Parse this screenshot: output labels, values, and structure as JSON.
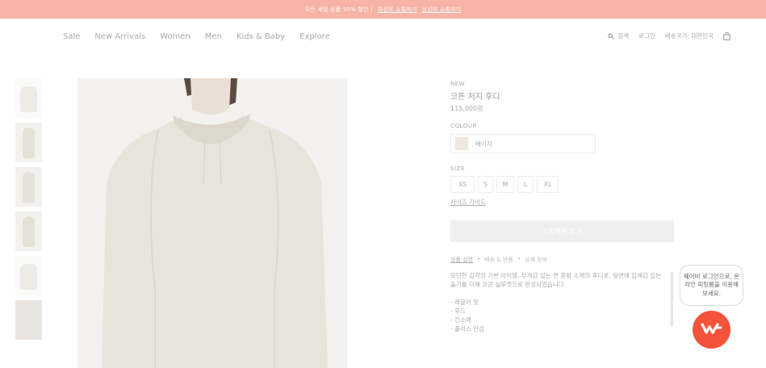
{
  "promo": {
    "text": "모든 세일 상품 50% 할인 |",
    "link_women": "여성의 쇼핑하기",
    "link_men": "남성의 쇼핑하기"
  },
  "nav": {
    "items": [
      "Sale",
      "New Arrivals",
      "Women",
      "Men",
      "Kids & Baby",
      "Explore"
    ]
  },
  "utility": {
    "search": "검색",
    "login": "로그인",
    "shipping": "배송국가: 대한민국",
    "icons": [
      "search-icon",
      "bag-icon"
    ]
  },
  "product": {
    "badge": "NEW",
    "name": "코튼 저지 후디",
    "price": "115,000원",
    "colour_label": "COLOUR",
    "colour_value": "베이지",
    "colour_swatch": "#efe8df",
    "size_label": "SIZE",
    "sizes": [
      "XS",
      "S",
      "M",
      "L",
      "XL"
    ],
    "size_guide": "사이즈 가이드",
    "add_to_cart": "쇼핑백에 담기",
    "tabs": [
      "상품 설명",
      "배송 & 반품",
      "상세 정보"
    ],
    "tab_separator": "•",
    "description": "모던한 감각의 기본 아이템. 무게감 있는 면 혼방 소재의 후디로, 뒷면에 압체감 있는 솔기를 더해 코쿤 실루엣으로 완성되었습니다.",
    "features": [
      "- 레귤러 핏",
      "- 후드",
      "- 긴소매",
      "- 플리스 안감"
    ]
  },
  "chat": {
    "bubble": "웨어비 로그인으로, 온라인 피팅룸을 이용해 보세요.",
    "fab_icon": "wearby-logo-icon",
    "accent": "#f4523a"
  },
  "colors": {
    "promo_bg": "#f6b3a6"
  }
}
